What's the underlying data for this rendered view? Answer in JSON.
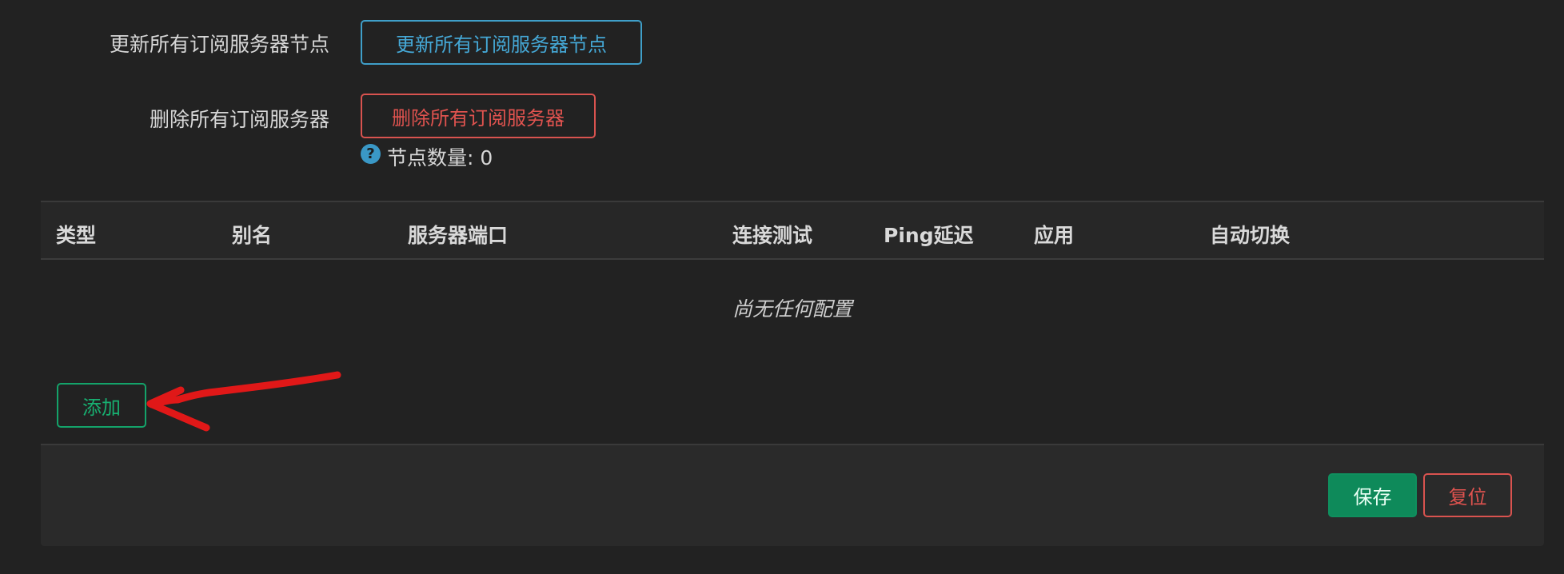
{
  "actions": {
    "update_nodes": {
      "label": "更新所有订阅服务器节点",
      "button": "更新所有订阅服务器节点"
    },
    "delete_servers": {
      "label": "删除所有订阅服务器",
      "button": "删除所有订阅服务器"
    },
    "node_count": "节点数量: 0",
    "help_icon_glyph": "?"
  },
  "table": {
    "columns": [
      "类型",
      "别名",
      "服务器端口",
      "连接测试",
      "Ping延迟",
      "应用",
      "自动切换"
    ],
    "empty_message": "尚无任何配置"
  },
  "add_button": "添加",
  "footer": {
    "save": "保存",
    "reset": "复位"
  },
  "colors": {
    "background": "#222222",
    "accent_blue": "#45a8d6",
    "danger_red": "#e0534f",
    "success_green": "#0e8a5a",
    "annotation_red": "#e01818"
  }
}
